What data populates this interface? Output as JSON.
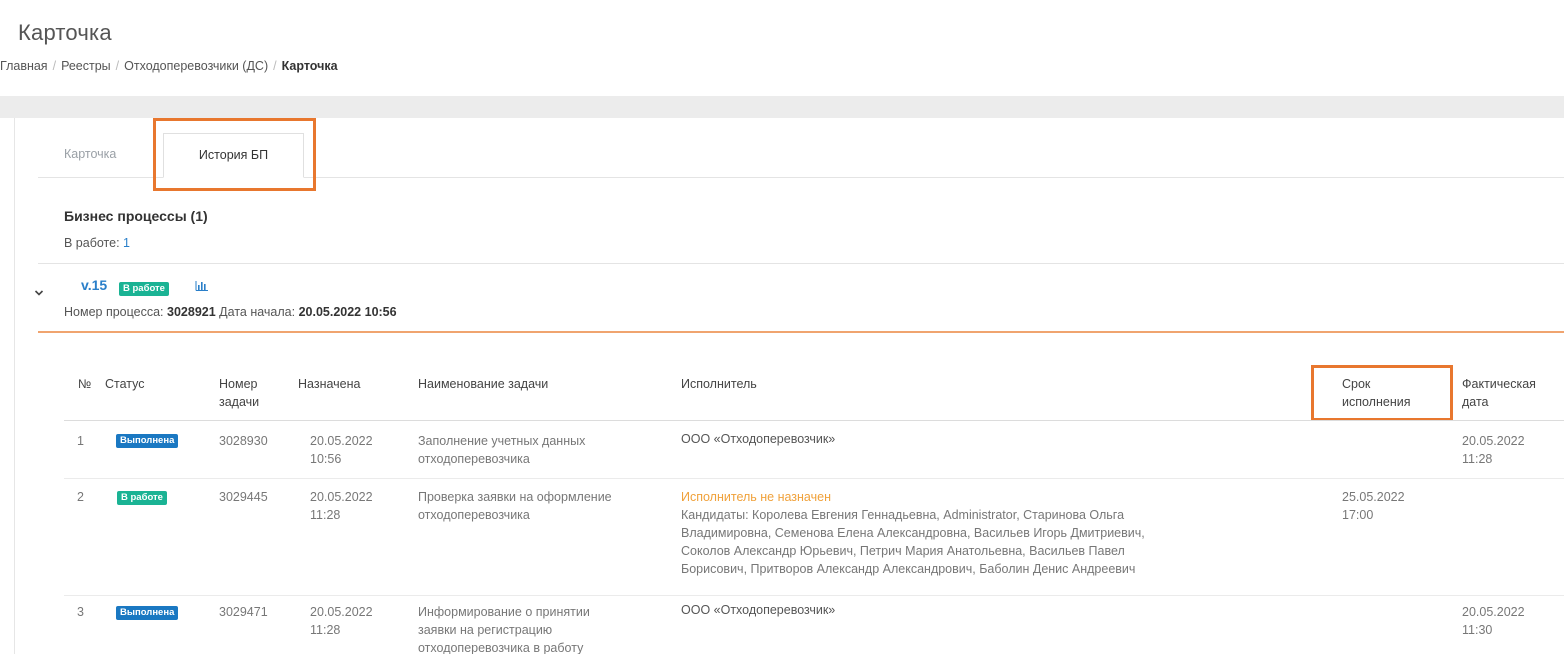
{
  "page": {
    "title": "Карточка"
  },
  "breadcrumb": {
    "items": [
      "Главная",
      "Реестры",
      "Отходоперевозчики (ДС)"
    ],
    "current": "Карточка"
  },
  "tabs": [
    {
      "label": "Карточка",
      "active": false
    },
    {
      "label": "История БП",
      "active": true
    }
  ],
  "business_processes": {
    "title": "Бизнес процессы (1)",
    "in_work_label": "В работе:",
    "in_work_count": "1"
  },
  "process": {
    "version": "v.15",
    "status": "В работе",
    "number_label": "Номер процесса:",
    "number": "3028921",
    "start_label": "Дата начала:",
    "start": "20.05.2022 10:56"
  },
  "table": {
    "headers": {
      "num": "№",
      "status": "Статус",
      "task_no_1": "Номер",
      "task_no_2": "задачи",
      "assigned": "Назначена",
      "name": "Наименование задачи",
      "executor": "Исполнитель",
      "deadline_1": "Срок",
      "deadline_2": "исполнения",
      "actual_1": "Фактическая",
      "actual_2": "дата"
    },
    "rows": [
      {
        "num": "1",
        "status": "Выполнена",
        "task_no": "3028930",
        "assigned_date": "20.05.2022",
        "assigned_time": "10:56",
        "name_1": "Заполнение учетных данных",
        "name_2": "отходоперевозчика",
        "name_3": "",
        "executor": "ООО «Отходоперевозчик»",
        "deadline_date": "",
        "deadline_time": "",
        "actual_date": "20.05.2022",
        "actual_time": "11:28"
      },
      {
        "num": "2",
        "status": "В работе",
        "task_no": "3029445",
        "assigned_date": "20.05.2022",
        "assigned_time": "11:28",
        "name_1": "Проверка заявки на оформление",
        "name_2": "отходоперевозчика",
        "name_3": "",
        "executor_warning": "Исполнитель не назначен",
        "candidates": [
          "Кандидаты: Королева Евгения Геннадьевна, Administrator, Старинова Ольга",
          "Владимировна, Семенова Елена Александровна, Васильев Игорь Дмитриевич,",
          "Соколов Александр Юрьевич, Петрич Мария Анатольевна, Васильев Павел",
          "Борисович, Притворов Александр Александрович, Баболин Денис Андреевич"
        ],
        "deadline_date": "25.05.2022",
        "deadline_time": "17:00",
        "actual_date": "",
        "actual_time": ""
      },
      {
        "num": "3",
        "status": "Выполнена",
        "task_no": "3029471",
        "assigned_date": "20.05.2022",
        "assigned_time": "11:28",
        "name_1": "Информирование о принятии",
        "name_2": "заявки на регистрацию",
        "name_3": "отходоперевозчика в работу",
        "executor": "ООО «Отходоперевозчик»",
        "deadline_date": "",
        "deadline_time": "",
        "actual_date": "20.05.2022",
        "actual_time": "11:30"
      }
    ]
  },
  "colors": {
    "accent_orange": "#e8772e",
    "link_blue": "#2a7fc9",
    "badge_green": "#1ab394",
    "badge_blue": "#1a78c2",
    "warning_orange": "#f0a13a"
  }
}
